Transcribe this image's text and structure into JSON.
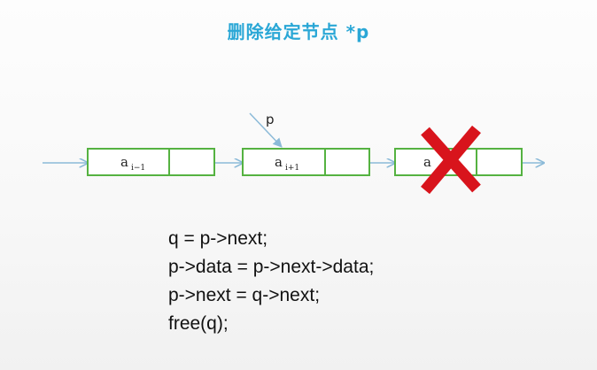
{
  "title": "删除给定节点 *p",
  "pointer_label": "p",
  "nodes": [
    {
      "base": "a",
      "sub": "i−1"
    },
    {
      "base": "a",
      "sub": "i+1"
    },
    {
      "base": "a",
      "sub": ""
    }
  ],
  "code": [
    "q = p->next;",
    "p->data = p->next->data;",
    "p->next = q->next;",
    "free(q);"
  ],
  "colors": {
    "title": "#2aa7d6",
    "node_border": "#55b241",
    "arrow": "#8bbad8",
    "cross": "#d8141c"
  }
}
